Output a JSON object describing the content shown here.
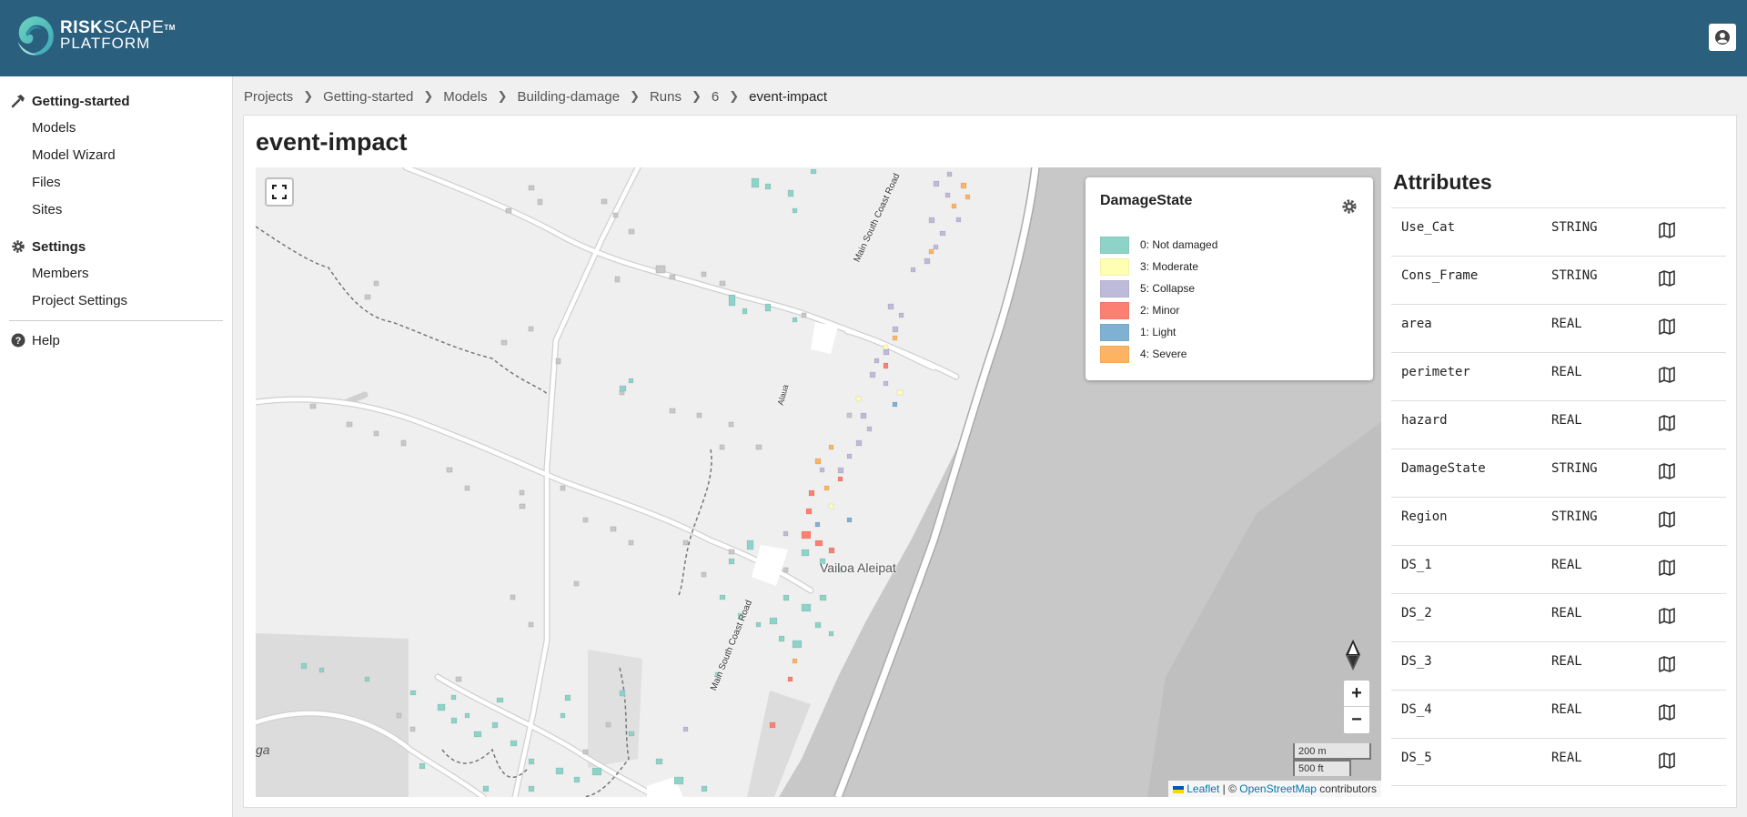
{
  "header": {
    "logo_line1_bold": "RISK",
    "logo_line1_thin": "SCAPE",
    "logo_tm": "TM",
    "logo_line2": "PLATFORM"
  },
  "sidebar": {
    "project_section": "Getting-started",
    "project_items": [
      "Models",
      "Model Wizard",
      "Files",
      "Sites"
    ],
    "settings_section": "Settings",
    "settings_items": [
      "Members",
      "Project Settings"
    ],
    "help_label": "Help"
  },
  "breadcrumb": {
    "items": [
      "Projects",
      "Getting-started",
      "Models",
      "Building-damage",
      "Runs",
      "6"
    ],
    "current": "event-impact"
  },
  "page": {
    "title": "event-impact"
  },
  "map": {
    "place_label": "Vailoa Aleipat",
    "road_label_top": "Main South Coast Road",
    "road_label_bottom": "Main South Coast Road",
    "road_label_small": "Alaua",
    "edge_label": "ga",
    "scale_metric": "200 m",
    "scale_imperial": "500 ft",
    "attribution_leaflet": "Leaflet",
    "attribution_sep": " | © ",
    "attribution_osm": "OpenStreetMap",
    "attribution_tail": " contributors",
    "zoom_in": "+",
    "zoom_out": "−",
    "legend": {
      "title": "DamageState",
      "entries": [
        {
          "label": "0: Not damaged",
          "color": "#8dd3c7"
        },
        {
          "label": "3: Moderate",
          "color": "#ffffb3"
        },
        {
          "label": "5: Collapse",
          "color": "#bebada"
        },
        {
          "label": "2: Minor",
          "color": "#fb8072"
        },
        {
          "label": "1: Light",
          "color": "#80b1d3"
        },
        {
          "label": "4: Severe",
          "color": "#fdb462"
        }
      ]
    }
  },
  "attributes": {
    "title": "Attributes",
    "rows": [
      {
        "name": "Use_Cat",
        "type": "STRING"
      },
      {
        "name": "Cons_Frame",
        "type": "STRING"
      },
      {
        "name": "area",
        "type": "REAL"
      },
      {
        "name": "perimeter",
        "type": "REAL"
      },
      {
        "name": "hazard",
        "type": "REAL"
      },
      {
        "name": "DamageState",
        "type": "STRING"
      },
      {
        "name": "Region",
        "type": "STRING"
      },
      {
        "name": "DS_1",
        "type": "REAL"
      },
      {
        "name": "DS_2",
        "type": "REAL"
      },
      {
        "name": "DS_3",
        "type": "REAL"
      },
      {
        "name": "DS_4",
        "type": "REAL"
      },
      {
        "name": "DS_5",
        "type": "REAL"
      }
    ]
  },
  "colors": {
    "header_bg": "#2b5f7e",
    "sea": "#c8c8c8",
    "land": "#efefef"
  }
}
